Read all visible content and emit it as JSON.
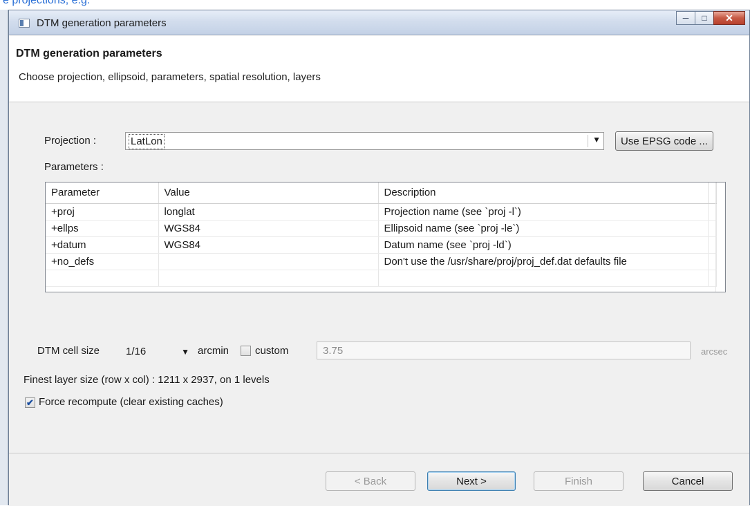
{
  "window": {
    "title": "DTM generation parameters"
  },
  "banner": {
    "title": "DTM generation parameters",
    "description": "Choose projection, ellipsoid, parameters, spatial resolution, layers"
  },
  "projection": {
    "label": "Projection :",
    "value": "LatLon",
    "epsg_button": "Use EPSG code ..."
  },
  "parameters": {
    "label": "Parameters :",
    "columns": [
      "Parameter",
      "Value",
      "Description"
    ],
    "rows": [
      [
        "+proj",
        "longlat",
        "Projection name (see `proj -l`)"
      ],
      [
        "+ellps",
        "WGS84",
        "Ellipsoid name (see `proj -le`)"
      ],
      [
        "+datum",
        "WGS84",
        "Datum name (see `proj -ld`)"
      ],
      [
        "+no_defs",
        "",
        "Don't use the /usr/share/proj/proj_def.dat defaults file"
      ],
      [
        "",
        "",
        ""
      ]
    ]
  },
  "cell_size": {
    "label": "DTM cell size",
    "value": "1/16",
    "unit": "arcmin",
    "custom_label": "custom",
    "custom_checked": false,
    "custom_value": "3.75",
    "custom_unit": "arcsec"
  },
  "layer_info": "Finest layer size (row x col) : 1211 x 2937, on 1 levels",
  "force_recompute": {
    "label": "Force recompute (clear existing caches)",
    "checked": true
  },
  "buttons": {
    "back": "< Back",
    "next": "Next >",
    "finish": "Finish",
    "cancel": "Cancel"
  },
  "top_strip_text": "e projections, e.g."
}
